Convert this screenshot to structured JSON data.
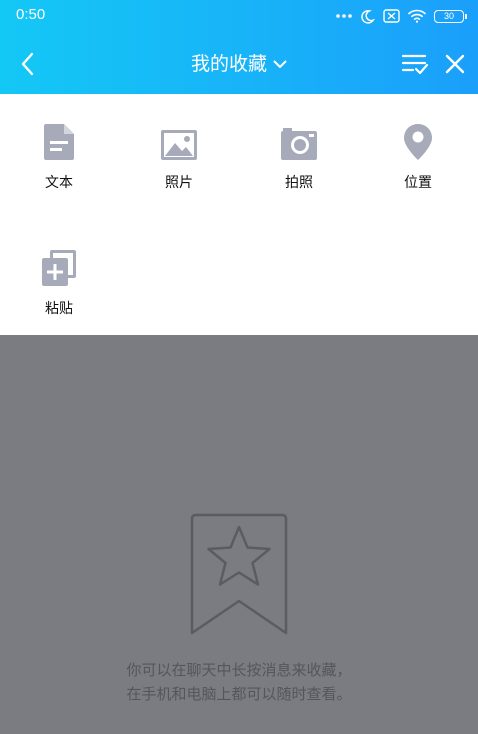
{
  "status_bar": {
    "time": "0:50",
    "battery": "30"
  },
  "nav": {
    "title": "我的收藏",
    "back_icon": "chevron-left-icon",
    "dropdown_icon": "chevron-down-icon",
    "select_icon": "multi-select-icon",
    "close_icon": "close-icon"
  },
  "actions": [
    {
      "label": "文本",
      "icon": "text-document-icon"
    },
    {
      "label": "照片",
      "icon": "photo-icon"
    },
    {
      "label": "拍照",
      "icon": "camera-icon"
    },
    {
      "label": "位置",
      "icon": "location-pin-icon"
    },
    {
      "label": "粘贴",
      "icon": "paste-icon"
    }
  ],
  "empty_state": {
    "icon": "bookmark-star-icon",
    "line1": "你可以在聊天中长按消息来收藏，",
    "line2": "在手机和电脑上都可以随时查看。"
  },
  "colors": {
    "header_start": "#14c8f5",
    "header_end": "#1a9ffb",
    "icon_gray": "#a7aab8",
    "overlay_gray": "#7b7b82"
  }
}
